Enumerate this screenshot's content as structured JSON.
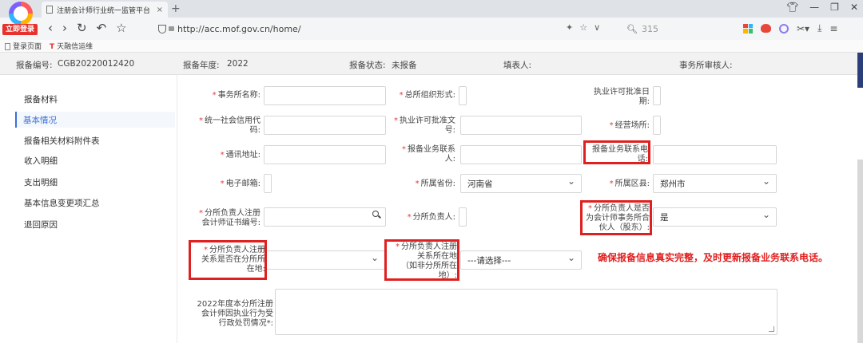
{
  "browser": {
    "badge": "立即登录",
    "tab_title": "注册会计师行业统一监管平台",
    "tab_close": "×",
    "new_tab": "+",
    "url": "http://acc.mof.gov.cn/home/",
    "search_text": "315",
    "bookmarks": [
      "登录页面",
      "天融信运维"
    ]
  },
  "header": {
    "report_no_label": "报备编号:",
    "report_no": "CGB20220012420",
    "year_label": "报备年度:",
    "year": "2022",
    "status_label": "报备状态:",
    "status": "未报备",
    "filler_label": "填表人:",
    "reviewer_label": "事务所审核人:"
  },
  "sidebar": {
    "items": [
      {
        "label": "报备材料"
      },
      {
        "label": "基本情况"
      },
      {
        "label": "报备相关材料附件表"
      },
      {
        "label": "收入明细"
      },
      {
        "label": "支出明细"
      },
      {
        "label": "基本信息变更项汇总"
      },
      {
        "label": "退回原因"
      }
    ]
  },
  "form": {
    "firm_name": "事务所名称:",
    "hq_form": "总所组织形式:",
    "license_date_1": "执业许可批准日",
    "license_date_2": "期:",
    "credit_code_1": "统一社会信用代",
    "credit_code_2": "码:",
    "license_no_1": "执业许可批准文",
    "license_no_2": "号:",
    "premises": "经营场所:",
    "address": "通讯地址:",
    "contact_1": "报备业务联系",
    "contact_2": "人:",
    "phone_1": "报备业务联系电",
    "phone_2": "话:",
    "email": "电子邮箱:",
    "province": "所属省份:",
    "province_value": "河南省",
    "district": "所属区县:",
    "district_value": "郑州市",
    "cert_no_1": "分所负责人注册",
    "cert_no_2": "会计师证书编号:",
    "head": "分所负责人:",
    "partner_1": "分所负责人是否",
    "partner_2": "为会计师事务所合",
    "partner_3": "伙人（股东）:",
    "partner_value": "是",
    "local_rel_1": "分所负责人注册",
    "local_rel_2": "关系是否在分所所",
    "local_rel_3": "在地:",
    "rel_place_1": "分所负责人注册",
    "rel_place_2": "关系所在地",
    "rel_place_3": "（如非分所所在",
    "rel_place_4": "地）:",
    "rel_place_value": "---请选择---",
    "penalty_1": "2022年度本分所注册",
    "penalty_2": "会计师因执业行为受",
    "penalty_3": "行政处罚情况*:"
  },
  "annotation": {
    "note": "确保报备信息真实完整，及时更新报备业务联系电话。",
    "color": "#e02020"
  },
  "icons": [
    "browser-logo",
    "document-icon",
    "back-icon",
    "forward-icon",
    "reload-icon",
    "undo-icon",
    "star-icon",
    "shield-icon",
    "search-icon",
    "chevron-down-icon"
  ]
}
